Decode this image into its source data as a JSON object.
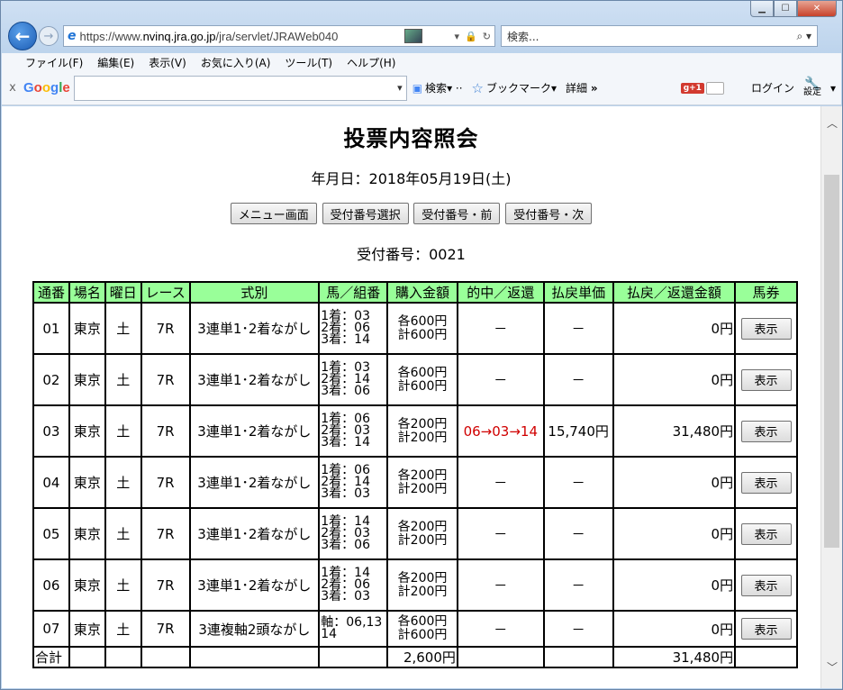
{
  "browser": {
    "address_url_prefix": "https://www.",
    "address_url_host": "nvinq.jra.go.jp",
    "address_url_path": "/jra/servlet/JRAWeb040",
    "search_placeholder": "検索...",
    "menu": [
      "ファイル(F)",
      "編集(E)",
      "表示(V)",
      "お気に入り(A)",
      "ツール(T)",
      "ヘルプ(H)"
    ],
    "google_toolbar": {
      "close_label": "x",
      "logo": "Google",
      "search_label": "検索",
      "bookmark_label": "ブックマーク",
      "details_label": "詳細",
      "more_label": "»",
      "gplus_label": "g+1",
      "login_label": "ログイン",
      "settings_label": "設定"
    }
  },
  "page": {
    "title": "投票内容照会",
    "date_line": "年月日：2018年05月19日(土)",
    "buttons": [
      "メニュー画面",
      "受付番号選択",
      "受付番号・前",
      "受付番号・次"
    ],
    "receipt_line": "受付番号：0021"
  },
  "table": {
    "headers": [
      "通番",
      "場名",
      "曜日",
      "レース",
      "式別",
      "馬／組番",
      "購入金額",
      "的中／返還",
      "払戻単価",
      "払戻／返還金額",
      "馬券"
    ],
    "rows": [
      {
        "no": "01",
        "venue": "東京",
        "day": "土",
        "race": "7R",
        "type": "3連単1･2着ながし",
        "horse1": "1着：03",
        "horse2": "2着：06",
        "horse3": "3着：14",
        "amt_each": "各600円",
        "amt_total": "計600円",
        "hit": "－",
        "unit": "－",
        "payout": "0円",
        "btn": "表示"
      },
      {
        "no": "02",
        "venue": "東京",
        "day": "土",
        "race": "7R",
        "type": "3連単1･2着ながし",
        "horse1": "1着：03",
        "horse2": "2着：14",
        "horse3": "3着：06",
        "amt_each": "各600円",
        "amt_total": "計600円",
        "hit": "－",
        "unit": "－",
        "payout": "0円",
        "btn": "表示"
      },
      {
        "no": "03",
        "venue": "東京",
        "day": "土",
        "race": "7R",
        "type": "3連単1･2着ながし",
        "horse1": "1着：06",
        "horse2": "2着：03",
        "horse3": "3着：14",
        "amt_each": "各200円",
        "amt_total": "計200円",
        "hit": "06→03→14",
        "unit": "15,740円",
        "payout": "31,480円",
        "btn": "表示"
      },
      {
        "no": "04",
        "venue": "東京",
        "day": "土",
        "race": "7R",
        "type": "3連単1･2着ながし",
        "horse1": "1着：06",
        "horse2": "2着：14",
        "horse3": "3着：03",
        "amt_each": "各200円",
        "amt_total": "計200円",
        "hit": "－",
        "unit": "－",
        "payout": "0円",
        "btn": "表示"
      },
      {
        "no": "05",
        "venue": "東京",
        "day": "土",
        "race": "7R",
        "type": "3連単1･2着ながし",
        "horse1": "1着：14",
        "horse2": "2着：03",
        "horse3": "3着：06",
        "amt_each": "各200円",
        "amt_total": "計200円",
        "hit": "－",
        "unit": "－",
        "payout": "0円",
        "btn": "表示"
      },
      {
        "no": "06",
        "venue": "東京",
        "day": "土",
        "race": "7R",
        "type": "3連単1･2着ながし",
        "horse1": "1着：14",
        "horse2": "2着：06",
        "horse3": "3着：03",
        "amt_each": "各200円",
        "amt_total": "計200円",
        "hit": "－",
        "unit": "－",
        "payout": "0円",
        "btn": "表示"
      },
      {
        "no": "07",
        "venue": "東京",
        "day": "土",
        "race": "7R",
        "type": "3連複軸2頭ながし",
        "horse1": "軸：06,13",
        "horse2": "14",
        "horse3": "",
        "amt_each": "各600円",
        "amt_total": "計600円",
        "hit": "－",
        "unit": "－",
        "payout": "0円",
        "btn": "表示"
      }
    ],
    "total": {
      "label": "合計",
      "amount": "2,600円",
      "payout": "31,480円"
    }
  },
  "colors": {
    "header_bg": "#99ff99",
    "hit_text": "#d00000"
  }
}
